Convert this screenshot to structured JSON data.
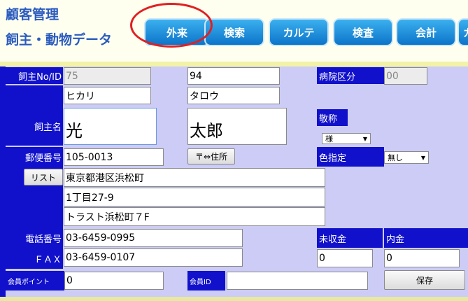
{
  "header": {
    "title_line1": "顧客管理",
    "title_line2": "飼主・動物データ",
    "nav": [
      "外来",
      "検索",
      "カルテ",
      "検査",
      "会計",
      "カ"
    ]
  },
  "form": {
    "owner_id_label": "飼主No/ID",
    "owner_no": "75",
    "owner_id": "94",
    "hospital_label": "病院区分",
    "hospital_value": "00",
    "kana_last": "ヒカリ",
    "kana_first": "タロウ",
    "name_label": "飼主名",
    "name_last": "光",
    "name_first": "太郎",
    "honorific_label": "敬称",
    "honorific_value": "様",
    "postal_label": "郵便番号",
    "postal_value": "105-0013",
    "postal_button": "〒⇔住所",
    "color_label": "色指定",
    "color_value": "無し",
    "list_button": "リスト",
    "address1": "東京都港区浜松町",
    "address2": "1丁目27-9",
    "address3": "トラスト浜松町７F",
    "phone_label": "電話番号",
    "phone_value": "03-6459-0995",
    "fax_label": "ＦＡＸ",
    "fax_value": "03-6459-0107",
    "unpaid_label": "未収金",
    "unpaid_value": "0",
    "deposit_label": "内金",
    "deposit_value": "0",
    "points_label": "会員ポイント",
    "points_value": "0",
    "member_id_label": "会員ID",
    "member_id_value": "",
    "save_button": "保存"
  },
  "colors": {
    "label_bg": "#1111cc",
    "nav_button": "#1a8ee0",
    "highlight_circle": "#e02020",
    "background": "#ccccf6"
  }
}
